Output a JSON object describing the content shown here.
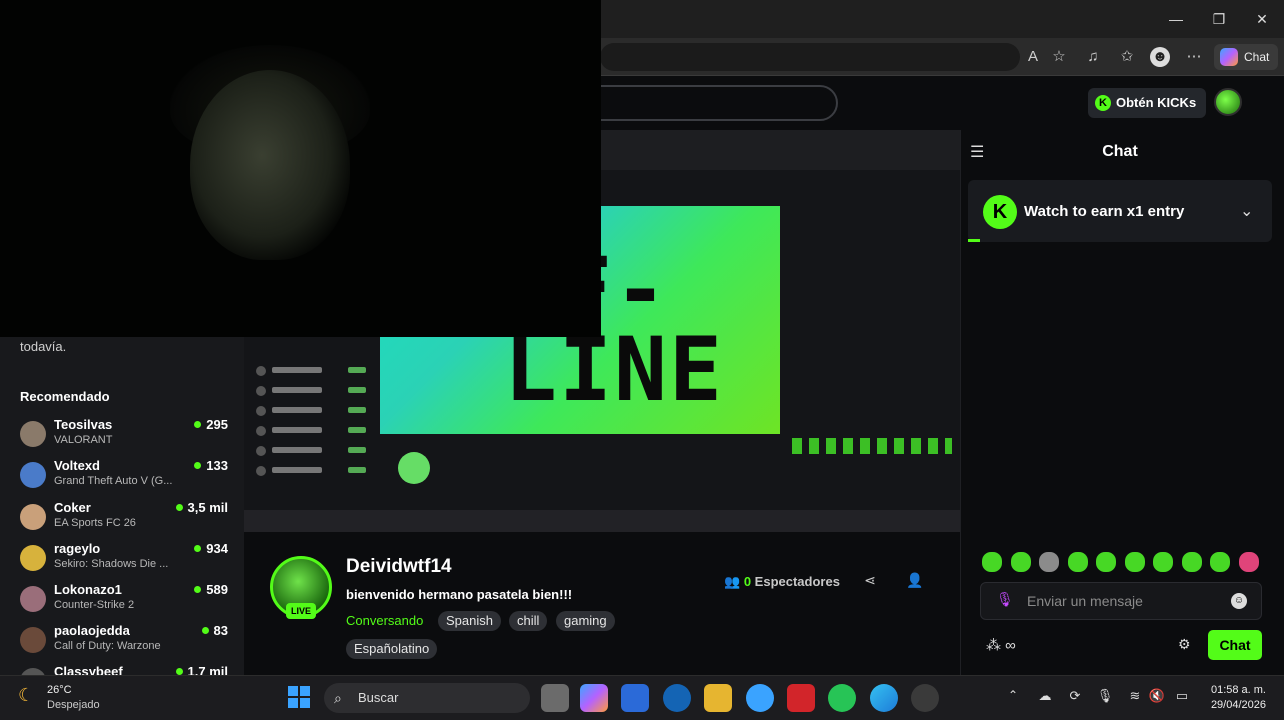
{
  "browser": {
    "copilot_label": "Chat",
    "minimize": "—",
    "maximize": "❐",
    "close": "✕"
  },
  "kick": {
    "get_kicks_label": "Obtén KICKs",
    "kick_logo_letter": "K"
  },
  "sidebar": {
    "top_text": "todavía.",
    "recommended_title": "Recomendado",
    "items": [
      {
        "name": "Teosilvas",
        "game": "VALORANT",
        "viewers": "295",
        "avatar_color": "#8a7a6a"
      },
      {
        "name": "Voltexd",
        "game": "Grand Theft Auto V (G...",
        "viewers": "133",
        "avatar_color": "#4a7bc9"
      },
      {
        "name": "Coker",
        "game": "EA Sports FC 26",
        "viewers": "3,5 mil",
        "avatar_color": "#c9a07a"
      },
      {
        "name": "rageylo",
        "game": "Sekiro: Shadows Die ...",
        "viewers": "934",
        "avatar_color": "#d7b23c"
      },
      {
        "name": "Lokonazo1",
        "game": "Counter-Strike 2",
        "viewers": "589",
        "avatar_color": "#9a6e7a"
      },
      {
        "name": "paolaojedda",
        "game": "Call of Duty: Warzone",
        "viewers": "83",
        "avatar_color": "#6a4a3a"
      },
      {
        "name": "Classybeef",
        "game": "",
        "viewers": "1,7 mil",
        "avatar_color": "#555555"
      }
    ]
  },
  "video": {
    "offline_text": "FF-\nLINE"
  },
  "stream": {
    "streamer_name": "Deividwtf14",
    "live_label": "LIVE",
    "title": "bienvenido hermano pasatela bien!!!",
    "category": "Conversando",
    "tags": [
      "Spanish",
      "chill",
      "gaming",
      "Españolatino"
    ],
    "viewers_count": "0",
    "viewers_label": "Espectadores"
  },
  "chat": {
    "heading": "Chat",
    "watch_text": "Watch to earn x1 entry",
    "input_placeholder": "Enviar un mensaje",
    "points": "∞",
    "send_label": "Chat"
  },
  "taskbar": {
    "temperature": "26°C",
    "weather": "Despejado",
    "search_label": "Buscar",
    "time": "01:58 a. m.",
    "date": "29/04/2026"
  },
  "colors": {
    "accent": "#53fc18",
    "background": "#0b0c0e"
  }
}
